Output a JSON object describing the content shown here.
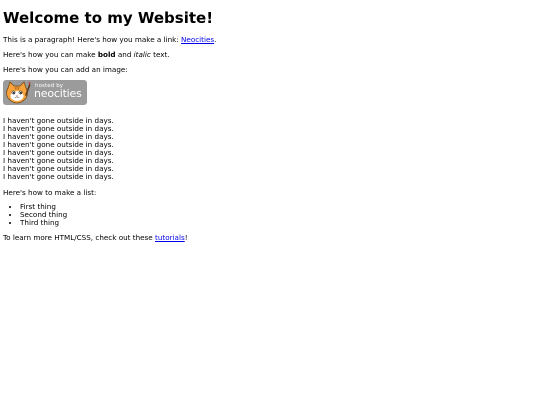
{
  "heading": "Welcome to my Website!",
  "intro": {
    "text": "This is a paragraph! Here's how you make a link: ",
    "link_label": "Neocities",
    "suffix": "."
  },
  "formatting": {
    "prefix": "Here's how you can make ",
    "bold": "bold",
    "middle": " and ",
    "italic": "italic",
    "suffix": " text."
  },
  "image_intro": "Here's how you can add an image:",
  "badge": {
    "icon": "neocities-cat-icon",
    "small_text": "hosted by",
    "brand_text": "neocities"
  },
  "repeated_lines": [
    "I haven't gone outside in days.",
    "I haven't gone outside in days.",
    "I haven't gone outside in days.",
    "I haven't gone outside in days.",
    "I haven't gone outside in days.",
    "I haven't gone outside in days.",
    "I haven't gone outside in days.",
    "I haven't gone outside in days."
  ],
  "list_intro": "Here's how to make a list:",
  "list_items": [
    "First thing",
    "Second thing",
    "Third thing"
  ],
  "outro": {
    "prefix": "To learn more HTML/CSS, check out these ",
    "link_label": "tutorials",
    "suffix": "!"
  },
  "colors": {
    "link": "#0000ee",
    "badge_background": "#9b9b9b",
    "cat_orange": "#f7a23c"
  }
}
